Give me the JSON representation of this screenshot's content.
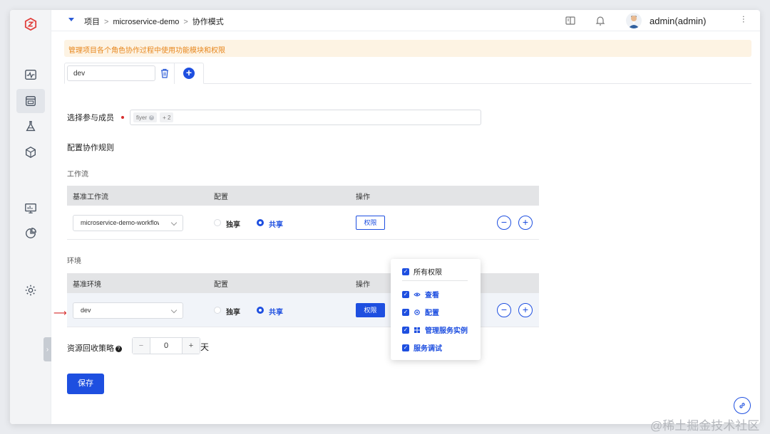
{
  "breadcrumb": {
    "items": [
      "项目",
      "microservice-demo",
      "协作模式"
    ],
    "sep": ">"
  },
  "header": {
    "user": "admin(admin)"
  },
  "notice": "管理项目各个角色协作过程中使用功能模块和权限",
  "tab": {
    "value": "dev",
    "add": "+"
  },
  "members": {
    "label": "选择参与成员",
    "chips": [
      "fiyer",
      "+ 2"
    ]
  },
  "rules_title": "配置协作规则",
  "workflow": {
    "section": "工作流",
    "headers": [
      "基准工作流",
      "配置",
      "操作"
    ],
    "row": {
      "select": "microservice-demo-workflow",
      "radio_exclusive": "独享",
      "radio_shared": "共享",
      "perm": "权限"
    }
  },
  "env": {
    "section": "环境",
    "headers": [
      "基准环境",
      "配置",
      "操作"
    ],
    "row": {
      "select": "dev",
      "radio_exclusive": "独享",
      "radio_shared": "共享",
      "perm": "权限"
    }
  },
  "recycle": {
    "label": "资源回收策略",
    "value": "0",
    "unit": "天",
    "minus": "−",
    "plus": "+"
  },
  "save": "保存",
  "popover": {
    "all": "所有权限",
    "items": [
      "查看",
      "配置",
      "管理服务实例",
      "服务调试"
    ]
  },
  "watermark": "@稀土掘金技术社区",
  "colors": {
    "primary": "#1e4fe0",
    "notice_bg": "#fdf3e3",
    "notice_text": "#e7861c"
  },
  "icons": [
    "logo-icon",
    "monitor-icon",
    "project-icon",
    "flask-icon",
    "package-icon",
    "dashboard-icon",
    "pie-chart-icon",
    "settings-icon",
    "book-icon",
    "bell-icon",
    "trash-icon",
    "eye-icon",
    "gear-icon",
    "grid-icon",
    "link-icon"
  ]
}
